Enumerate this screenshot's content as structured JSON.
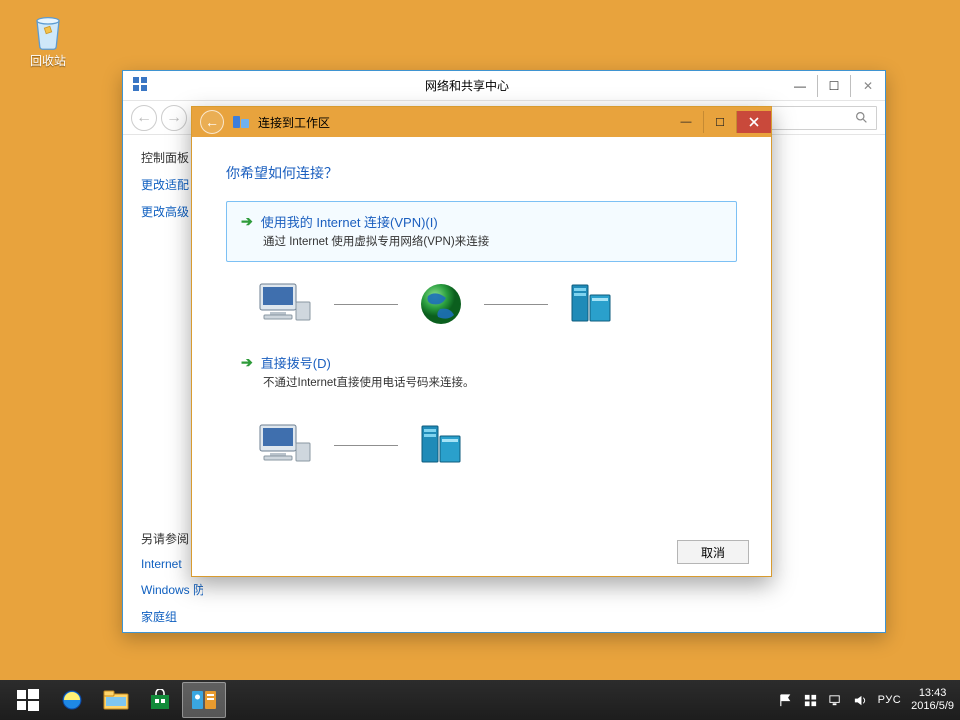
{
  "desktop": {
    "recycle_bin_label": "回收站"
  },
  "bg_window": {
    "title": "网络和共享中心",
    "sidebar": {
      "control_panel": "控制面板",
      "change_adapter": "更改适配",
      "change_advanced": "更改高级",
      "see_also": "另请参阅",
      "internet": "Internet",
      "windows": "Windows 防火墙",
      "homegroup": "家庭组"
    }
  },
  "wizard": {
    "title": "连接到工作区",
    "heading": "你希望如何连接？",
    "option_vpn": {
      "title": "使用我的 Internet 连接(VPN)(I)",
      "desc": "通过 Internet 使用虚拟专用网络(VPN)来连接"
    },
    "option_dial": {
      "title": "直接拨号(D)",
      "desc": "不通过Internet直接使用电话号码来连接。"
    },
    "cancel": "取消"
  },
  "taskbar": {
    "lang": "РУС",
    "time": "13:43",
    "date": "2016/5/9"
  },
  "colors": {
    "desktop_bg": "#e8a33d",
    "wizard_accent": "#1b5fbf",
    "close_btn": "#c9493b"
  }
}
